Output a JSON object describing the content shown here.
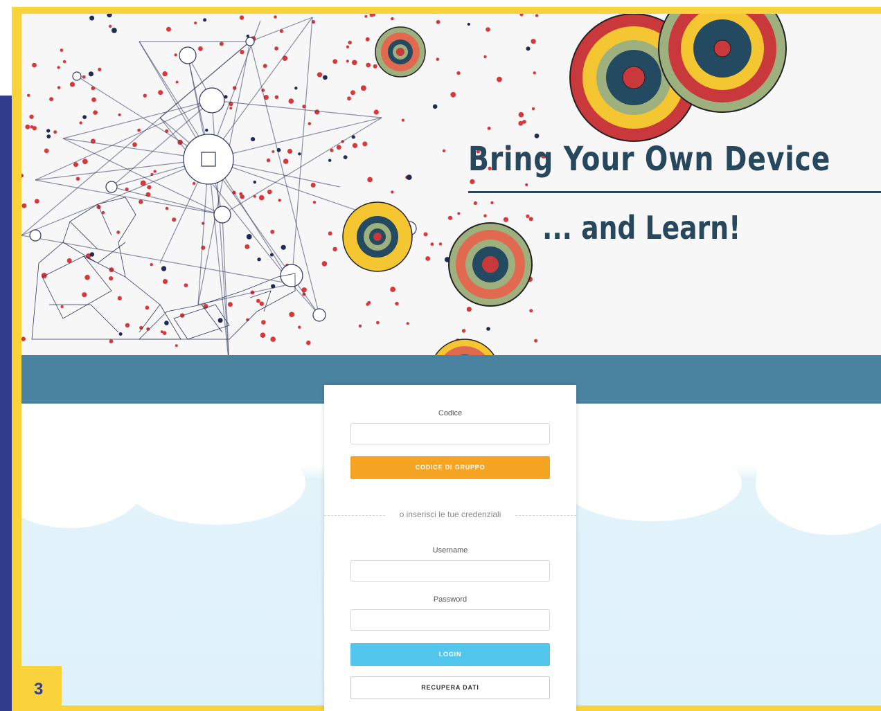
{
  "banner": {
    "title": "Bring Your Own Device",
    "subtitle": "... and Learn!"
  },
  "login": {
    "codice_label": "Codice",
    "codice_value": "",
    "group_code_button": "CODICE DI GRUPPO",
    "separator_text": "o inserisci le tue credenziali",
    "username_label": "Username",
    "username_value": "",
    "password_label": "Password",
    "password_value": "",
    "login_button": "LOGIN",
    "recover_button": "RECUPERA DATI"
  },
  "slide": {
    "page_number": "3"
  },
  "colors": {
    "navy": "#323c8c",
    "yellow": "#f9d33b",
    "teal": "#4a83a0",
    "orange_button": "#f5a424",
    "blue_button": "#53c6ee",
    "title_text": "#27475d"
  }
}
